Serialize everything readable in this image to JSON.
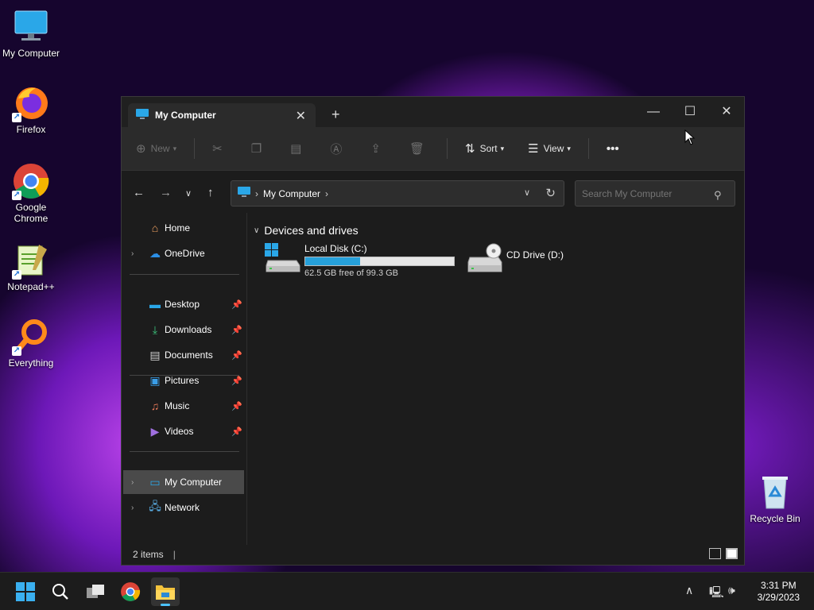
{
  "desktop": {
    "icons": [
      {
        "label": "My Computer"
      },
      {
        "label": "Firefox"
      },
      {
        "label": "Google Chrome"
      },
      {
        "label": "Notepad++"
      },
      {
        "label": "Everything"
      },
      {
        "label": "Recycle Bin"
      }
    ]
  },
  "window": {
    "tab_title": "My Computer",
    "toolbar": {
      "new_label": "New",
      "sort_label": "Sort",
      "view_label": "View"
    },
    "address": {
      "crumb": "My Computer"
    },
    "search": {
      "placeholder": "Search My Computer"
    },
    "sidebar": {
      "home": "Home",
      "onedrive": "OneDrive",
      "desktop": "Desktop",
      "downloads": "Downloads",
      "documents": "Documents",
      "pictures": "Pictures",
      "music": "Music",
      "videos": "Videos",
      "my_computer": "My Computer",
      "network": "Network"
    },
    "content": {
      "group_title": "Devices and drives",
      "drives": [
        {
          "name": "Local Disk (C:)",
          "free_text": "62.5 GB free of 99.3 GB",
          "used_fraction": 0.37
        },
        {
          "name": "CD Drive (D:)"
        }
      ]
    },
    "status": {
      "items": "2 items"
    }
  },
  "taskbar": {
    "time": "3:31 PM",
    "date": "3/29/2023"
  },
  "colors": {
    "accent": "#26a0da",
    "window_bg": "#1c1c1c",
    "toolbar_bg": "#2b2b2b"
  }
}
